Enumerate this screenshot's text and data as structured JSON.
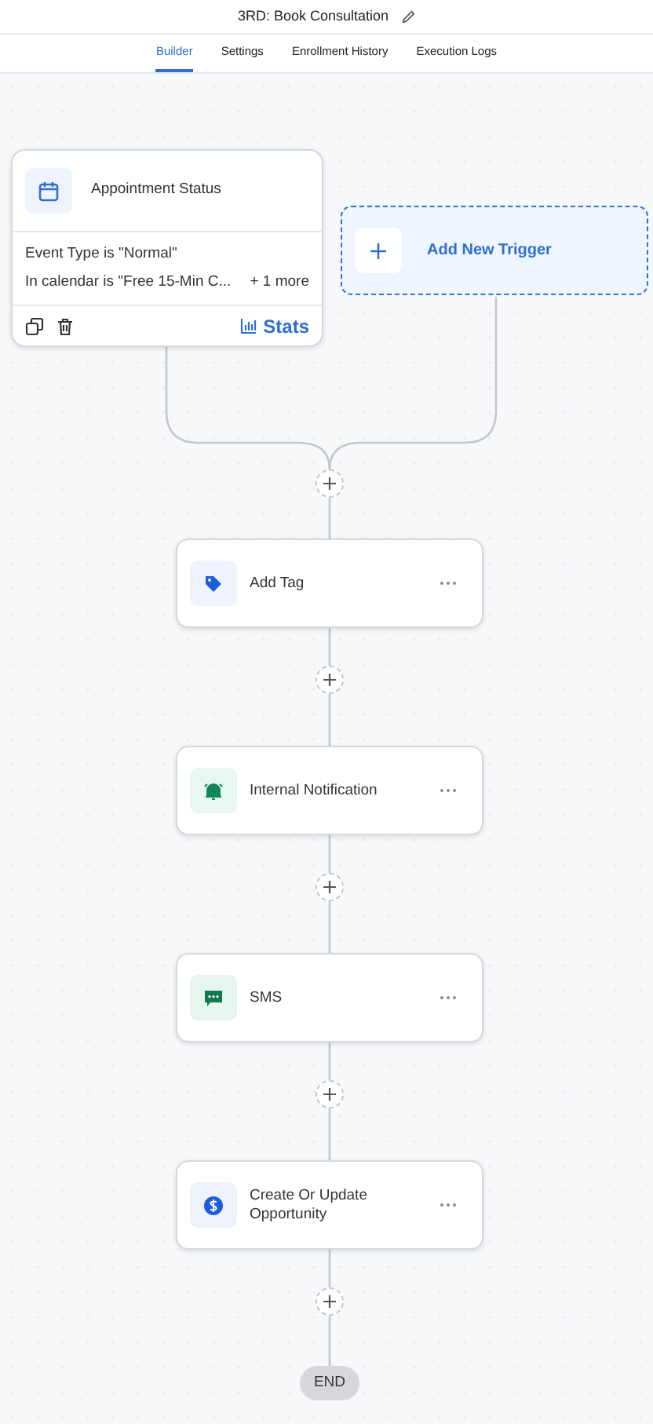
{
  "header": {
    "title": "3RD: Book Consultation"
  },
  "tabs": [
    {
      "label": "Builder",
      "selected": true
    },
    {
      "label": "Settings",
      "selected": false
    },
    {
      "label": "Enrollment History",
      "selected": false
    },
    {
      "label": "Execution Logs",
      "selected": false
    }
  ],
  "trigger": {
    "title": "Appointment Status",
    "conditions": [
      "Event Type is \"Normal\"",
      "In calendar is \"Free 15-Min C..."
    ],
    "more": "+ 1 more",
    "stats": "Stats"
  },
  "add_trigger": {
    "label": "Add New Trigger"
  },
  "actions": [
    {
      "kind": "tag",
      "label": "Add Tag"
    },
    {
      "kind": "notification",
      "label": "Internal Notification"
    },
    {
      "kind": "sms",
      "label": "SMS"
    },
    {
      "kind": "opportunity",
      "label": "Create Or Update Opportunity"
    }
  ],
  "end": "END"
}
